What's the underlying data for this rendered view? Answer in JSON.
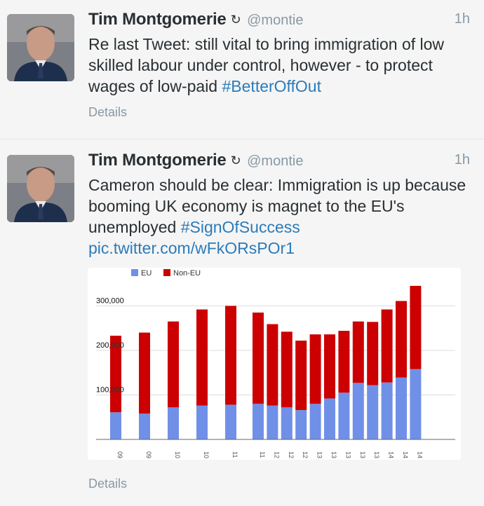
{
  "tweets": [
    {
      "name": "Tim Montgomerie",
      "name_icon": "refresh-icon",
      "handle": "@montie",
      "time": "1h",
      "text_parts": {
        "body": "Re last Tweet: still vital to bring immigration of low skilled labour under control, however - to protect wages of low-paid ",
        "hashtag": "#BetterOffOut"
      },
      "details_label": "Details"
    },
    {
      "name": "Tim Montgomerie",
      "name_icon": "refresh-icon",
      "handle": "@montie",
      "time": "1h",
      "text_parts": {
        "body": "Cameron should be clear: Immigration is up because booming UK economy is magnet to the EU's unemployed ",
        "hashtag": "#SignOfSuccess",
        "link": "pic.twitter.com/wFkORsPOr1"
      },
      "details_label": "Details"
    }
  ],
  "colors": {
    "eu": "#7090e8",
    "non_eu": "#cc0000",
    "link": "#2b7bb9",
    "muted": "#8899a6"
  },
  "chart_data": {
    "type": "bar",
    "stacked": true,
    "legend": [
      "EU",
      "Non-EU"
    ],
    "legend_position": "top-left",
    "ylim": [
      0,
      370000
    ],
    "y_ticks": [
      "100,000",
      "200,000",
      "300,000"
    ],
    "grid": true,
    "categories": [
      "09",
      "09",
      "10",
      "10",
      "11",
      "11",
      "12",
      "12",
      "12",
      "13",
      "13",
      "13",
      "13",
      "13",
      "14",
      "14",
      "14",
      "14",
      "14"
    ],
    "series": [
      {
        "name": "EU",
        "values": [
          61000,
          58000,
          72000,
          76000,
          78000,
          80000,
          76000,
          72000,
          66000,
          80000,
          92000,
          105000,
          127000,
          122000,
          128000,
          139000,
          158000
        ]
      },
      {
        "name": "Non-EU",
        "values": [
          172000,
          182000,
          193000,
          216000,
          222000,
          205000,
          183000,
          170000,
          156000,
          156000,
          144000,
          139000,
          138000,
          142000,
          164000,
          172000,
          187000
        ]
      }
    ],
    "bar_totals": [
      233000,
      240000,
      265000,
      292000,
      300000,
      285000,
      259000,
      242000,
      222000,
      236000,
      236000,
      244000,
      265000,
      264000,
      292000,
      311000,
      345000
    ],
    "tick_labels_visible": [
      "09",
      "09",
      "10",
      "10",
      "11",
      "11",
      "12",
      "12",
      "12",
      "13",
      "13",
      "13",
      "13",
      "13",
      "14",
      "14",
      "14"
    ]
  }
}
